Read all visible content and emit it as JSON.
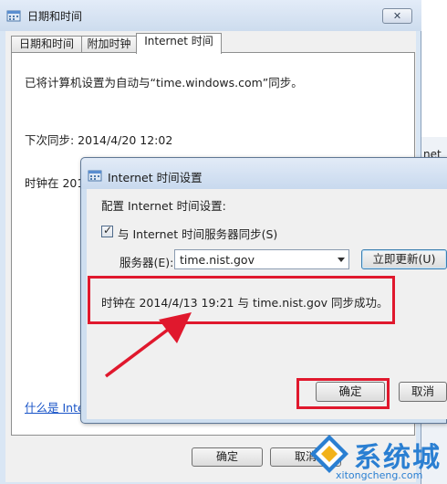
{
  "outer_window": {
    "title": "日期和时间",
    "close_label": "✕",
    "tabs": [
      {
        "label": "日期和时间"
      },
      {
        "label": "附加时钟"
      },
      {
        "label": "Internet 时间"
      }
    ],
    "panel": {
      "sync_setting_text": "已将计算机设置为自动与“time.windows.com”同步。",
      "next_sync_text": "下次同步: 2014/4/20 12:02",
      "clock_partial_text": "时钟在 201",
      "help_link_partial": "什么是 Inte"
    },
    "buttons": {
      "ok_label": "确定",
      "cancel_partial_label": "取消"
    }
  },
  "background_window": {
    "edge_text": "net"
  },
  "dialog": {
    "title": "Internet 时间设置",
    "config_label": "配置 Internet 时间设置:",
    "sync_checkbox_label": "与 Internet 时间服务器同步(S)",
    "sync_checked": true,
    "server_label": "服务器(E):",
    "server_value": "time.nist.gov",
    "update_button_label": "立即更新(U)",
    "status_message": "时钟在 2014/4/13 19:21 与 time.nist.gov 同步成功。",
    "ok_label": "确定",
    "cancel_label": "取消"
  },
  "annotation_color": "#e0182d",
  "watermark": {
    "text": "系统城",
    "sub": "xitongcheng.com"
  }
}
